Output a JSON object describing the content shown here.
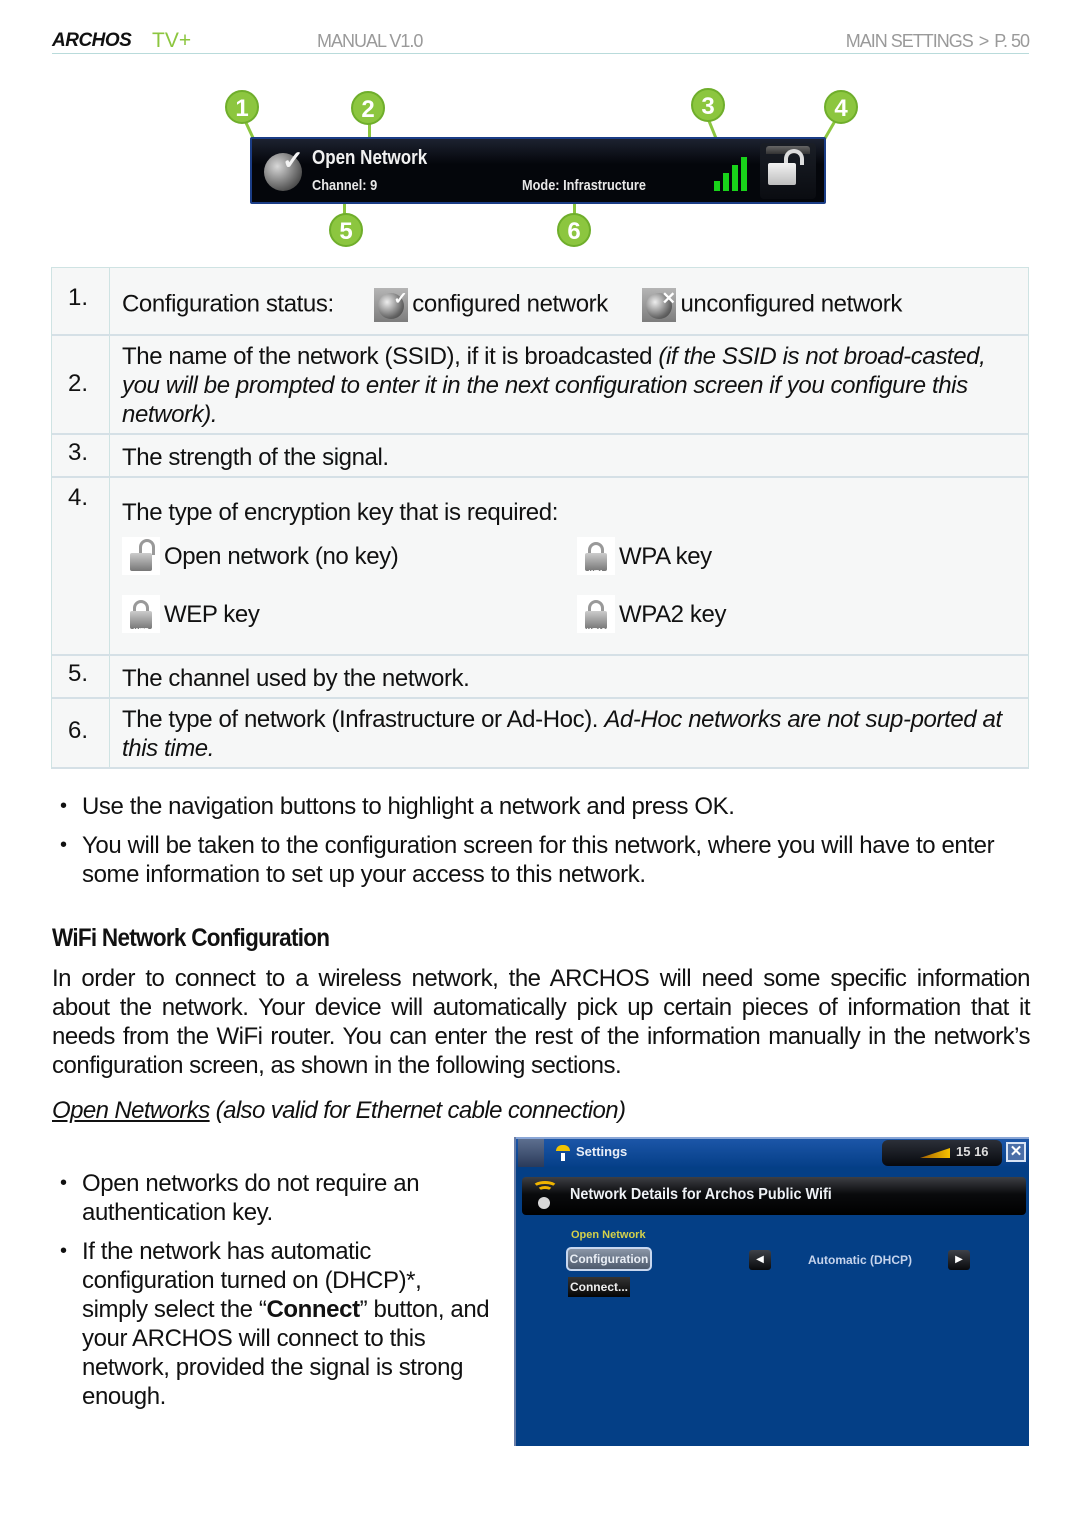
{
  "header": {
    "brand": "ARCHOS",
    "model": "TV+",
    "manual": "MANUAL V1.0",
    "section": "MAIN SETTINGS",
    "separator": ">",
    "page": "P. 50"
  },
  "banner": {
    "callouts": [
      "1",
      "2",
      "3",
      "4",
      "5",
      "6"
    ],
    "ssid": "Open Network",
    "channel": "Channel: 9",
    "mode": "Mode: Infrastructure",
    "signal_bars": 4,
    "signal_max": 4,
    "signal_color": "#19d31a",
    "callout_color": "#8cc63f"
  },
  "table": {
    "rows": [
      {
        "num": "1.",
        "label": "Configuration status:",
        "configured": "configured network",
        "unconfigured": "unconfigured network"
      },
      {
        "num": "2.",
        "text": "The name of the network (SSID), if it is broadcasted ",
        "italic": "(if the SSID is not broad-casted, you will be prompted to enter it in the next configuration screen if you configure this network)."
      },
      {
        "num": "3.",
        "text": "The strength of the signal."
      },
      {
        "num": "4.",
        "text": "The type of encryption key that is required:",
        "keys": [
          {
            "icon": "open-lock-icon",
            "label": "Open network (no key)"
          },
          {
            "icon": "wpa-lock-icon",
            "label": "WPA key",
            "tag": "WPA"
          },
          {
            "icon": "wep-lock-icon",
            "label": "WEP key",
            "tag": "WEP"
          },
          {
            "icon": "wpa2-lock-icon",
            "label": "WPA2 key",
            "tag": "WPA2"
          }
        ]
      },
      {
        "num": "5.",
        "text": "The channel used by the network."
      },
      {
        "num": "6.",
        "text": "The type of network (Infrastructure or Ad-Hoc). ",
        "italic": "Ad-Hoc networks are not sup-ported at this time."
      }
    ]
  },
  "bullets1": [
    "Use the navigation buttons to highlight a network and press OK.",
    "You will be taken to the configuration screen for this network, where you will have to enter some information to set up your access to this network."
  ],
  "section": {
    "heading": "WiFi Network Configuration",
    "paragraph": "In order to connect to a wireless network, the ARCHOS will need some specific information about the network. Your device will automatically pick up certain pieces of information that it needs from the WiFi router. You can enter the rest of the information manually in the network’s configuration screen, as shown in the following sections.",
    "subheading_link": "Open Networks",
    "subheading_rest": " (also valid for Ethernet cable connection)"
  },
  "bullets2": {
    "item1": "Open networks do not require an authentication key.",
    "item2_pre": "If the network has automatic configuration turned on (DHCP)*, simply select the “",
    "item2_bold": "Connect",
    "item2_post": "” button, and your ARCHOS will connect to this network, provided the signal is strong enough."
  },
  "device": {
    "app_title": "Settings",
    "time": "15 16",
    "close_glyph": "✕",
    "title": "Network Details for Archos Public Wifi",
    "network_type": "Open Network",
    "config_button": "Configuration",
    "connect_button": "Connect...",
    "ip_mode": "Automatic (DHCP)",
    "arrow_left": "◀",
    "arrow_right": "▶",
    "bg_color": "#043f86"
  }
}
